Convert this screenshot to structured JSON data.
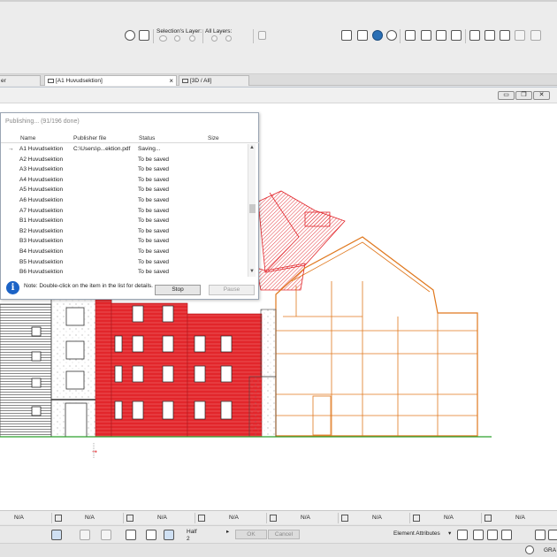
{
  "toolbar": {
    "selections_layer_label": "Selection's Layer:",
    "all_layers_label": "All Layers:"
  },
  "tabs": [
    {
      "label": "er",
      "active": false
    },
    {
      "label": "[A1 Huvudsektion]",
      "active": true
    },
    {
      "label": "[3D / All]",
      "active": false
    }
  ],
  "dialog": {
    "title": "Publishing... (91/196 done)",
    "columns": {
      "name": "Name",
      "file": "Publisher file",
      "status": "Status",
      "size": "Size"
    },
    "rows": [
      {
        "name": "A1 Huvudsektion",
        "file": "C:\\Users\\p...ektion.pdf",
        "status": "Saving...",
        "current": true
      },
      {
        "name": "A2 Huvudsektion",
        "file": "",
        "status": "To be saved",
        "current": false
      },
      {
        "name": "A3 Huvudsektion",
        "file": "",
        "status": "To be saved",
        "current": false
      },
      {
        "name": "A4 Huvudsektion",
        "file": "",
        "status": "To be saved",
        "current": false
      },
      {
        "name": "A5 Huvudsektion",
        "file": "",
        "status": "To be saved",
        "current": false
      },
      {
        "name": "A6 Huvudsektion",
        "file": "",
        "status": "To be saved",
        "current": false
      },
      {
        "name": "A7 Huvudsektion",
        "file": "",
        "status": "To be saved",
        "current": false
      },
      {
        "name": "B1 Huvudsektion",
        "file": "",
        "status": "To be saved",
        "current": false
      },
      {
        "name": "B2 Huvudsektion",
        "file": "",
        "status": "To be saved",
        "current": false
      },
      {
        "name": "B3 Huvudsektion",
        "file": "",
        "status": "To be saved",
        "current": false
      },
      {
        "name": "B4 Huvudsektion",
        "file": "",
        "status": "To be saved",
        "current": false
      },
      {
        "name": "B5 Huvudsektion",
        "file": "",
        "status": "To be saved",
        "current": false
      },
      {
        "name": "B6 Huvudsektion",
        "file": "",
        "status": "To be saved",
        "current": false
      }
    ],
    "note": "Note: Double-click on the item in the list for details.",
    "stop_label": "Stop",
    "pause_label": "Pause",
    "current_arrow": "→"
  },
  "statusbar": {
    "na_values": [
      "N/A",
      "N/A",
      "N/A",
      "N/A",
      "N/A",
      "N/A",
      "N/A",
      "N/A"
    ]
  },
  "bottombar": {
    "half_label": "Half",
    "half_value": "2",
    "ok_label": "OK",
    "cancel_label": "Cancel",
    "element_attributes_label": "Element Attributes",
    "gra_label": "GRA"
  },
  "window_buttons": {
    "minimize": "▭",
    "restore": "❐",
    "close": "✕"
  },
  "colors": {
    "accent_blue": "#1c63c6",
    "drawing_red": "#e2262b",
    "drawing_orange": "#e0781e",
    "ground_green": "#2ca02c"
  }
}
